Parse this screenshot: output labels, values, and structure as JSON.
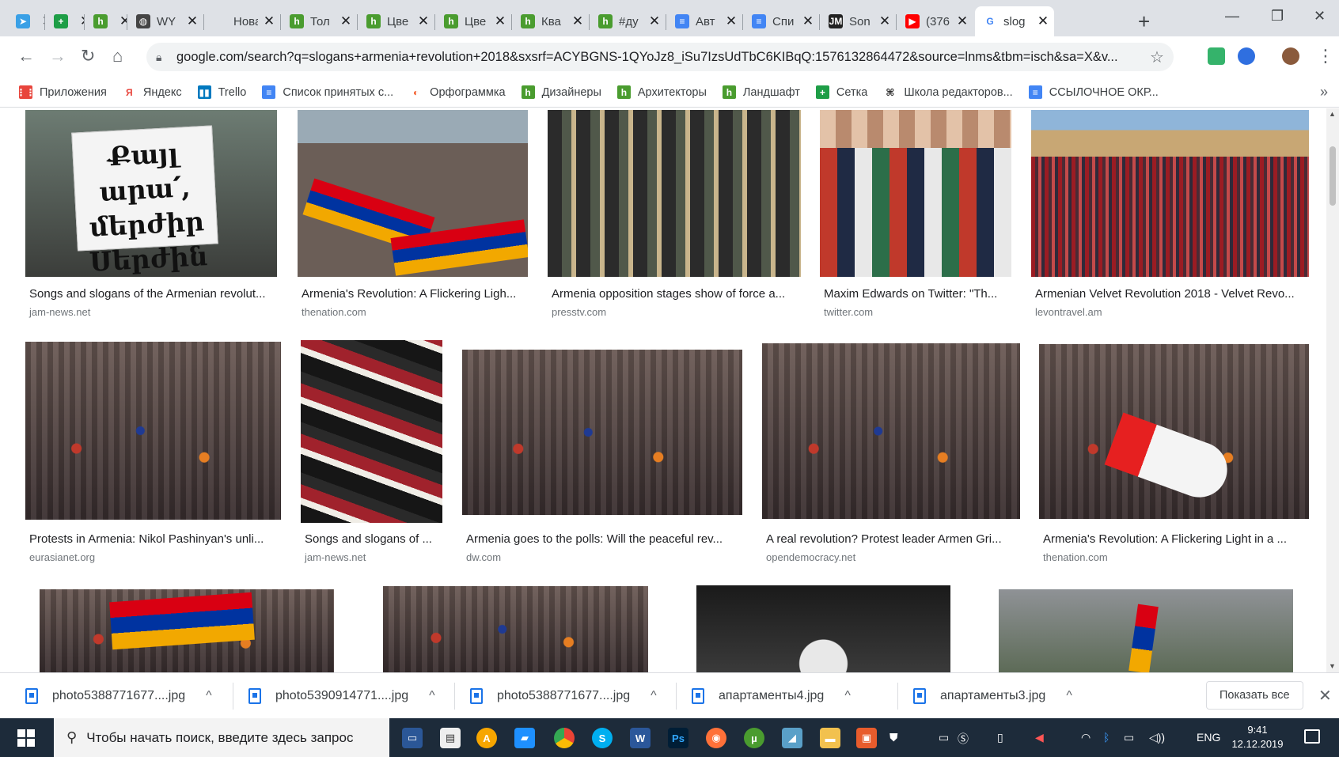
{
  "tabs": [
    {
      "label": "",
      "color": "#3aa0e6",
      "glyph": "➤"
    },
    {
      "label": "",
      "color": "#1e9e47",
      "glyph": "+"
    },
    {
      "label": "",
      "color": "#4a9c2f",
      "glyph": "h"
    },
    {
      "label": "WY",
      "color": "#444444",
      "glyph": "◍"
    },
    {
      "label": "Новая в",
      "color": "#dee1e6",
      "glyph": ""
    },
    {
      "label": "Тол",
      "color": "#4a9c2f",
      "glyph": "h"
    },
    {
      "label": "Цве",
      "color": "#4a9c2f",
      "glyph": "h"
    },
    {
      "label": "Цве",
      "color": "#4a9c2f",
      "glyph": "h"
    },
    {
      "label": "Ква",
      "color": "#4a9c2f",
      "glyph": "h"
    },
    {
      "label": "#ду",
      "color": "#4a9c2f",
      "glyph": "h"
    },
    {
      "label": "Авт",
      "color": "#4285f4",
      "glyph": "≡"
    },
    {
      "label": "Спи",
      "color": "#4285f4",
      "glyph": "≡"
    },
    {
      "label": "Son",
      "color": "#222222",
      "glyph": "JM"
    },
    {
      "label": "(376",
      "color": "#ff0000",
      "glyph": "▶"
    },
    {
      "label": "slog",
      "color": "#ffffff",
      "glyph": "G"
    }
  ],
  "toolbar": {
    "url": "google.com/search?q=slogans+armenia+revolution+2018&sxsrf=ACYBGNS-1QYoJz8_iSu7IzsUdTbC6KIBqQ:1576132864472&source=lnms&tbm=isch&sa=X&v..."
  },
  "bookmarks": [
    {
      "label": "Приложения",
      "color": "#e8453c",
      "glyph": "⋮⋮"
    },
    {
      "label": "Яндекс",
      "color": "#ffffff",
      "glyph": "Я"
    },
    {
      "label": "Trello",
      "color": "#0079bf",
      "glyph": "▮▮"
    },
    {
      "label": "Список принятых с...",
      "color": "#4285f4",
      "glyph": "≡"
    },
    {
      "label": "Орфограммка",
      "color": "#ffffff",
      "glyph": "◐"
    },
    {
      "label": "Дизайнеры",
      "color": "#4a9c2f",
      "glyph": "h"
    },
    {
      "label": "Архитекторы",
      "color": "#4a9c2f",
      "glyph": "h"
    },
    {
      "label": "Ландшафт",
      "color": "#4a9c2f",
      "glyph": "h"
    },
    {
      "label": "Сетка",
      "color": "#1e9e47",
      "glyph": "+"
    },
    {
      "label": "Школа редакторов...",
      "color": "#ffffff",
      "glyph": "⌘"
    },
    {
      "label": "ССЫЛОЧНОЕ ОКР...",
      "color": "#4285f4",
      "glyph": "≡"
    }
  ],
  "results_row1": [
    {
      "caption": "Songs and slogans of the Armenian revolut...",
      "domain": "jam-news.net",
      "sign": "Քայլ արա՛, մերժիր Սերժին"
    },
    {
      "caption": "Armenia's Revolution: A Flickering Ligh...",
      "domain": "thenation.com"
    },
    {
      "caption": "Armenia opposition stages show of force a...",
      "domain": "presstv.com"
    },
    {
      "caption": "Maxim Edwards on Twitter: \"Th...",
      "domain": "twitter.com"
    },
    {
      "caption": "Armenian Velvet Revolution 2018 - Velvet Revo...",
      "domain": "levontravel.am"
    }
  ],
  "results_row2": [
    {
      "caption": "Protests in Armenia: Nikol Pashinyan's unli...",
      "domain": "eurasianet.org"
    },
    {
      "caption": "Songs and slogans of ...",
      "domain": "jam-news.net"
    },
    {
      "caption": "Armenia goes to the polls: Will the peaceful rev...",
      "domain": "dw.com"
    },
    {
      "caption": "A real revolution? Protest leader Armen Gri...",
      "domain": "opendemocracy.net"
    },
    {
      "caption": "Armenia's Revolution: A Flickering Light in a ...",
      "domain": "thenation.com"
    }
  ],
  "downloads": [
    {
      "name": "photo5388771677....jpg"
    },
    {
      "name": "photo5390914771....jpg"
    },
    {
      "name": "photo5388771677....jpg"
    },
    {
      "name": "апартаменты4.jpg"
    },
    {
      "name": "апартаменты3.jpg"
    }
  ],
  "downloads_show_all": "Показать все",
  "taskbar": {
    "search_placeholder": "Чтобы начать поиск, введите здесь запрос",
    "lang": "ENG",
    "time": "9:41",
    "date": "12.12.2019"
  }
}
